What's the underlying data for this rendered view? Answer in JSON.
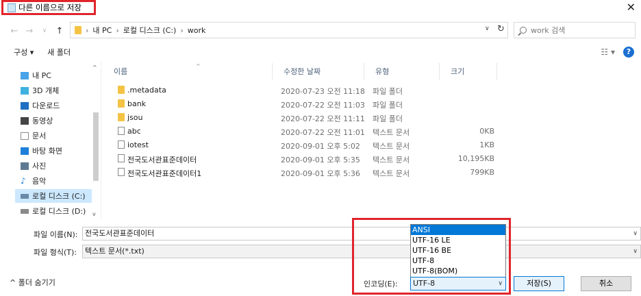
{
  "window": {
    "title": "다른 이름으로 저장",
    "close_glyph": "✕"
  },
  "nav": {
    "back_glyph": "←",
    "forward_glyph": "→",
    "recent_glyph": "∨",
    "up_glyph": "↑"
  },
  "address": {
    "crumbs": [
      "내 PC",
      "로컬 디스크 (C:)",
      "work"
    ],
    "separator": "›",
    "dropdown_glyph": "∨",
    "refresh_glyph": "↻"
  },
  "search": {
    "placeholder": "work 검색"
  },
  "toolbar": {
    "organize_label": "구성 ▾",
    "new_folder_label": "새 폴더",
    "view_glyph": "☷ ▾",
    "help_glyph": "?"
  },
  "sidebar": {
    "items": [
      {
        "label": "내 PC",
        "icon": "pc-icon",
        "color": "#4aa3e8"
      },
      {
        "label": "3D 개체",
        "icon": "cube-icon",
        "color": "#3fb1e0"
      },
      {
        "label": "다운로드",
        "icon": "download-icon",
        "color": "#1f6fc2"
      },
      {
        "label": "동영상",
        "icon": "video-icon",
        "color": "#444444"
      },
      {
        "label": "문서",
        "icon": "document-icon",
        "color": "#8a8a8a"
      },
      {
        "label": "바탕 화면",
        "icon": "desktop-icon",
        "color": "#1d7fd8"
      },
      {
        "label": "사진",
        "icon": "picture-icon",
        "color": "#5f7a94"
      },
      {
        "label": "음악",
        "icon": "music-icon",
        "color": "#1d7fd8"
      },
      {
        "label": "로컬 디스크 (C:)",
        "icon": "drive-icon",
        "color": "#6a8aa8"
      },
      {
        "label": "로컬 디스크 (D:)",
        "icon": "drive-icon",
        "color": "#8a8a8a"
      }
    ],
    "selected_index": 8,
    "scroll_up_glyph": "^",
    "scroll_down_glyph": "v"
  },
  "filelist": {
    "columns": {
      "name": "이름",
      "date": "수정한 날짜",
      "type": "유형",
      "size": "크기"
    },
    "rows": [
      {
        "name": ".metadata",
        "date": "2020-07-23 오전 11:18",
        "type": "파일 폴더",
        "size": "",
        "kind": "folder"
      },
      {
        "name": "bank",
        "date": "2020-07-22 오전 11:03",
        "type": "파일 폴더",
        "size": "",
        "kind": "folder"
      },
      {
        "name": "jsou",
        "date": "2020-07-22 오전 11:11",
        "type": "파일 폴더",
        "size": "",
        "kind": "folder"
      },
      {
        "name": "abc",
        "date": "2020-07-22 오전 11:01",
        "type": "텍스트 문서",
        "size": "0KB",
        "kind": "doc"
      },
      {
        "name": "iotest",
        "date": "2020-09-01 오후 5:02",
        "type": "텍스트 문서",
        "size": "1KB",
        "kind": "doc"
      },
      {
        "name": "전국도서관표준데이터",
        "date": "2020-09-01 오후 5:35",
        "type": "텍스트 문서",
        "size": "10,195KB",
        "kind": "doc"
      },
      {
        "name": "전국도서관표준데이터1",
        "date": "2020-09-01 오후 5:36",
        "type": "텍스트 문서",
        "size": "799KB",
        "kind": "doc"
      }
    ]
  },
  "form": {
    "filename_label": "파일 이름(N):",
    "filename_value": "전국도서관표준데이터",
    "filetype_label": "파일 형식(T):",
    "filetype_value": "텍스트 문서(*.txt)",
    "dropdown_glyph": "∨"
  },
  "footer": {
    "hide_folders_label": "^ 폴더 숨기기",
    "encoding_label": "인코딩(E):",
    "encoding_value": "UTF-8",
    "encoding_options": [
      "ANSI",
      "UTF-16 LE",
      "UTF-16 BE",
      "UTF-8",
      "UTF-8(BOM)"
    ],
    "encoding_highlighted_index": 0,
    "save_label": "저장(S)",
    "cancel_label": "취소"
  },
  "colors": {
    "highlight_red": "#e0242b",
    "selection_blue": "#0078d7",
    "nav_selected_bg": "#cce8ff",
    "folder_yellow": "#f4c344"
  }
}
